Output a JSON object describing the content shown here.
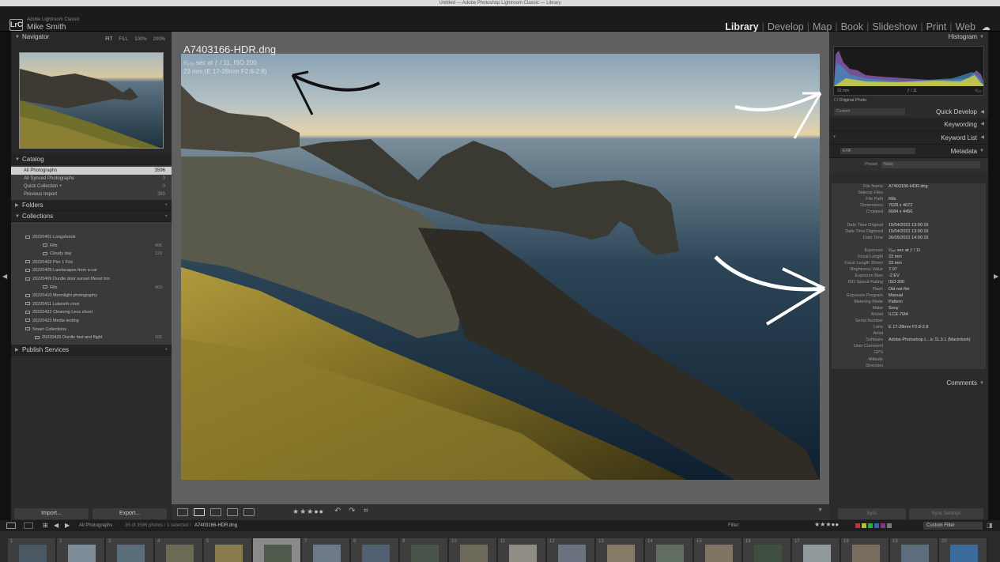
{
  "window": {
    "title": "Untitled — Adobe Photoshop Lightroom Classic — Library"
  },
  "identity": {
    "adobe_id": "Adobe Lightroom Classic",
    "user": "Mike Smith",
    "logo": "LrC"
  },
  "modules": [
    {
      "label": "Library",
      "active": true
    },
    {
      "label": "Develop"
    },
    {
      "label": "Map"
    },
    {
      "label": "Book"
    },
    {
      "label": "Slideshow"
    },
    {
      "label": "Print"
    },
    {
      "label": "Web"
    }
  ],
  "left": {
    "navigator": {
      "title": "Navigator",
      "zoom": [
        "FIT",
        "FILL",
        "100%",
        "200%"
      ]
    },
    "catalog": {
      "title": "Catalog",
      "items": [
        {
          "label": "All Photographs",
          "count": "3596",
          "selected": true
        },
        {
          "label": "All Synced Photographs",
          "count": "0"
        },
        {
          "label": "Quick Collection +",
          "count": "0"
        },
        {
          "label": "Previous Import",
          "count": "380"
        }
      ]
    },
    "folders": {
      "title": "Folders"
    },
    "collections": {
      "title": "Collections",
      "items": [
        {
          "label": "20220401 Longshotok",
          "count": "",
          "indent": 1
        },
        {
          "label": "Rifs",
          "count": "406",
          "indent": 2
        },
        {
          "label": "Cloudy day",
          "count": "123",
          "indent": 2
        },
        {
          "label": "20220402 Pier 1 Firs",
          "count": "",
          "indent": 1
        },
        {
          "label": "20220409 Landscapes from a car",
          "count": "",
          "indent": 1
        },
        {
          "label": "20220409 Durdle door sunset lifeout trio",
          "count": "",
          "indent": 1
        },
        {
          "label": "Rifs",
          "count": "403",
          "indent": 2
        },
        {
          "label": "20220410 Moonlight photography",
          "count": "",
          "indent": 1
        },
        {
          "label": "20220411 Lulworth cove",
          "count": "",
          "indent": 1
        },
        {
          "label": "20220422 Cleaning Lens shoot",
          "count": "",
          "indent": 1
        },
        {
          "label": "20220423 Media testing",
          "count": "",
          "indent": 1
        },
        {
          "label": "Smart Collections",
          "count": "",
          "indent": 1
        },
        {
          "label": "20220426 Durdle fast and flight",
          "count": "165",
          "indent": 1
        }
      ]
    },
    "publish": {
      "title": "Publish Services"
    },
    "buttons": {
      "import": "Import...",
      "export": "Export..."
    }
  },
  "photo": {
    "filename": "A7403166-HDR.dng",
    "exposure": "¹⁄₂₅₀ sec at ƒ / 11, ISO 200",
    "lens": "23 mm (E 17-28mm F2.8-2.8)"
  },
  "right": {
    "histogram": {
      "title": "Histogram",
      "low": "23 mm",
      "mid": "ƒ / 11",
      "high": "¹⁄₂₅₀",
      "original": "Original Photo"
    },
    "quick_develop": {
      "title": "Quick Develop",
      "preset": "Custom"
    },
    "keywording": {
      "title": "Keywording"
    },
    "keyword_list": {
      "title": "Keyword List"
    },
    "metadata": {
      "title": "Metadata",
      "mode": "EXIF",
      "preset_label": "Preset",
      "preset_value": "None"
    },
    "meta_rows": [
      {
        "k": "File Name",
        "v": "A7403166-HDR.dng"
      },
      {
        "k": "Sidecar Files",
        "v": ""
      },
      {
        "k": "File Path",
        "v": "Rifs"
      },
      {
        "k": "Dimensions",
        "v": "7028 x 4672"
      },
      {
        "k": "Cropped",
        "v": "6684 x 4456"
      },
      {
        "k": "",
        "v": ""
      },
      {
        "k": "Date Time Original",
        "v": "15/04/2022 13:00:16"
      },
      {
        "k": "Date Time Digitized",
        "v": "15/04/2022 13:00:16"
      },
      {
        "k": "Date Time",
        "v": "26/05/2022 14:00:15"
      },
      {
        "k": "",
        "v": ""
      },
      {
        "k": "Exposure",
        "v": "¹⁄₂₅₀ sec at ƒ / 11"
      },
      {
        "k": "Focal Length",
        "v": "23 mm"
      },
      {
        "k": "Focal Length 35mm",
        "v": "23 mm"
      },
      {
        "k": "Brightness Value",
        "v": "7.07"
      },
      {
        "k": "Exposure Bias",
        "v": "-2 EV"
      },
      {
        "k": "ISO Speed Rating",
        "v": "ISO 200"
      },
      {
        "k": "Flash",
        "v": "Did not fire"
      },
      {
        "k": "Exposure Program",
        "v": "Manual"
      },
      {
        "k": "Metering Mode",
        "v": "Pattern"
      },
      {
        "k": "Make",
        "v": "Sony"
      },
      {
        "k": "Model",
        "v": "ILCE-7M4"
      },
      {
        "k": "Serial Number",
        "v": ""
      },
      {
        "k": "Lens",
        "v": "E 17-28mm F2.8-2.8"
      },
      {
        "k": "Artist",
        "v": ""
      },
      {
        "k": "Software",
        "v": "Adobe Photoshop L...ic 11.3.1 (Macintosh)"
      },
      {
        "k": "User Comment",
        "v": ""
      },
      {
        "k": "GPS",
        "v": ""
      },
      {
        "k": "Altitude",
        "v": ""
      },
      {
        "k": "Direction",
        "v": ""
      }
    ],
    "comments": {
      "title": "Comments"
    },
    "buttons": {
      "sync": "Sync",
      "sync_settings": "Sync Settings"
    }
  },
  "statusbar": {
    "source": "All Photographs",
    "count": "35 of 3596 photos / 1 selected /",
    "file": "A7403166-HDR.dng",
    "filter_label": "Filter:",
    "filter_value": "Custom Filter"
  },
  "filmstrip": {
    "numbers": [
      "1",
      "2",
      "3",
      "4",
      "5",
      "6",
      "7",
      "8",
      "9",
      "10",
      "11",
      "12",
      "13",
      "14",
      "15",
      "16",
      "17",
      "18",
      "19",
      "20"
    ]
  },
  "colors": {
    "panel": "#2b2b2b",
    "accent": "#cfcfcf",
    "background": "#606060"
  }
}
